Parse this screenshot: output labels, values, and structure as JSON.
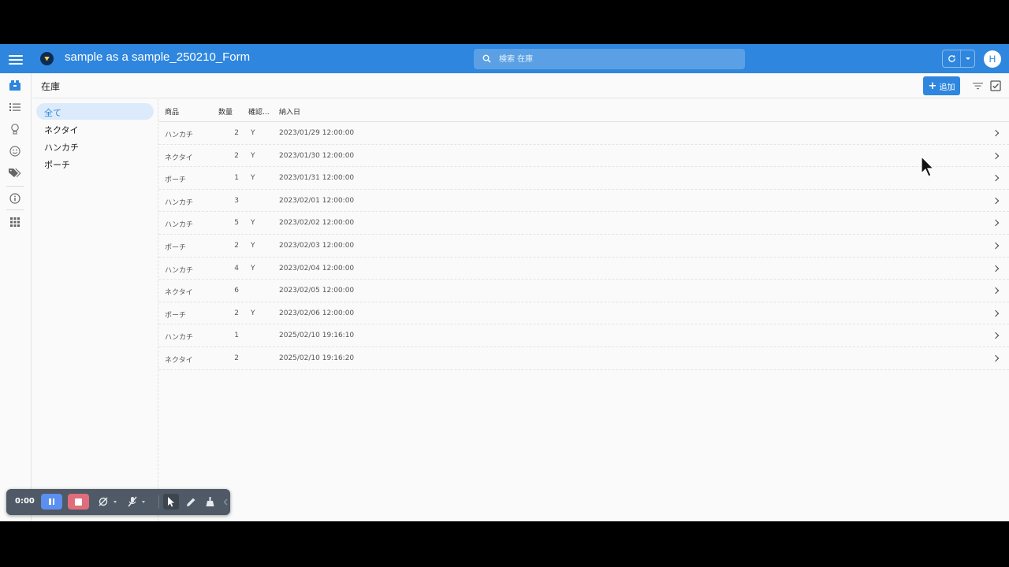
{
  "appbar": {
    "title": "sample as a sample_250210_Form",
    "search_placeholder": "検索 在庫",
    "avatar_initial": "H"
  },
  "header": {
    "title": "在庫",
    "add_label": "追加"
  },
  "rail": {
    "items": [
      "inventory-icon",
      "list-icon",
      "lightbulb-icon",
      "smiley-icon",
      "tags-icon",
      "info-icon",
      "apps-grid-icon"
    ]
  },
  "categories": {
    "items": [
      "全て",
      "ネクタイ",
      "ハンカチ",
      "ポーチ"
    ],
    "active_index": 0
  },
  "table": {
    "columns": [
      "商品",
      "数量",
      "確認...",
      "納入日"
    ],
    "rows": [
      {
        "product": "ハンカチ",
        "qty": "2",
        "confirmed": "Y",
        "date": "2023/01/29 12:00:00"
      },
      {
        "product": "ネクタイ",
        "qty": "2",
        "confirmed": "Y",
        "date": "2023/01/30 12:00:00"
      },
      {
        "product": "ポーチ",
        "qty": "1",
        "confirmed": "Y",
        "date": "2023/01/31 12:00:00"
      },
      {
        "product": "ハンカチ",
        "qty": "3",
        "confirmed": "",
        "date": "2023/02/01 12:00:00"
      },
      {
        "product": "ハンカチ",
        "qty": "5",
        "confirmed": "Y",
        "date": "2023/02/02 12:00:00"
      },
      {
        "product": "ポーチ",
        "qty": "2",
        "confirmed": "Y",
        "date": "2023/02/03 12:00:00"
      },
      {
        "product": "ハンカチ",
        "qty": "4",
        "confirmed": "Y",
        "date": "2023/02/04 12:00:00"
      },
      {
        "product": "ネクタイ",
        "qty": "6",
        "confirmed": "",
        "date": "2023/02/05 12:00:00"
      },
      {
        "product": "ポーチ",
        "qty": "2",
        "confirmed": "Y",
        "date": "2023/02/06 12:00:00"
      },
      {
        "product": "ハンカチ",
        "qty": "1",
        "confirmed": "",
        "date": "2025/02/10 19:16:10"
      },
      {
        "product": "ネクタイ",
        "qty": "2",
        "confirmed": "",
        "date": "2025/02/10 19:16:20"
      }
    ]
  },
  "recorder": {
    "time": "0:00"
  },
  "colors": {
    "brand": "#2e86de",
    "active_category_bg": "#dcebfb",
    "recorder_bg": "#505a66",
    "pause": "#5b8ff0",
    "stop": "#e06d7c"
  }
}
